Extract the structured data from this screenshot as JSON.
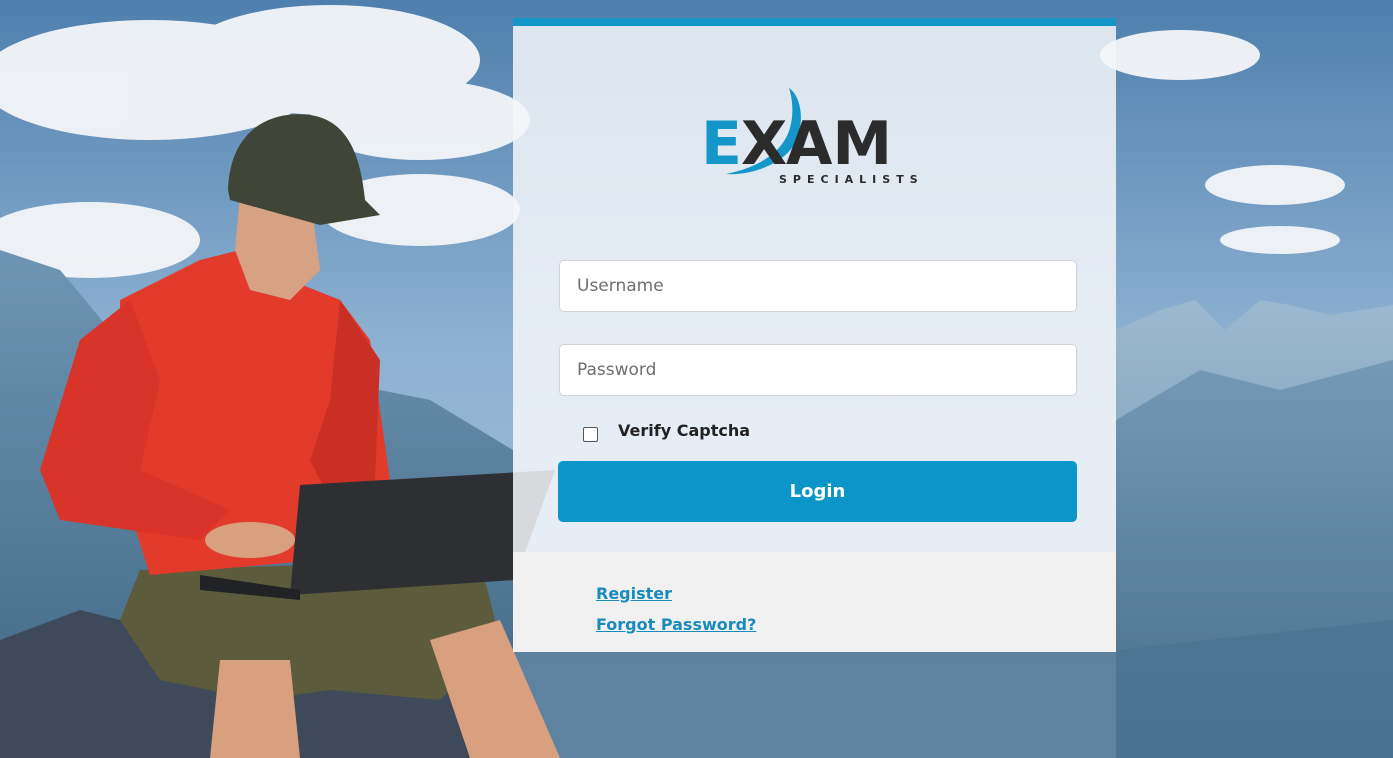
{
  "brand": {
    "name_part1": "E",
    "name_part2": "X",
    "name_part3": "AM",
    "tagline": "SPECIALISTS",
    "accent_color": "#1596c8",
    "dark_color": "#2b2b2b"
  },
  "login_form": {
    "username_placeholder": "Username",
    "password_placeholder": "Password",
    "captcha_label": "Verify Captcha",
    "captcha_checked": false,
    "login_button_label": "Login",
    "button_color": "#0b95c9"
  },
  "footer_links": {
    "register": "Register",
    "forgot_password": "Forgot Password?"
  },
  "background": {
    "scene": "man-with-laptop-on-mountain"
  }
}
